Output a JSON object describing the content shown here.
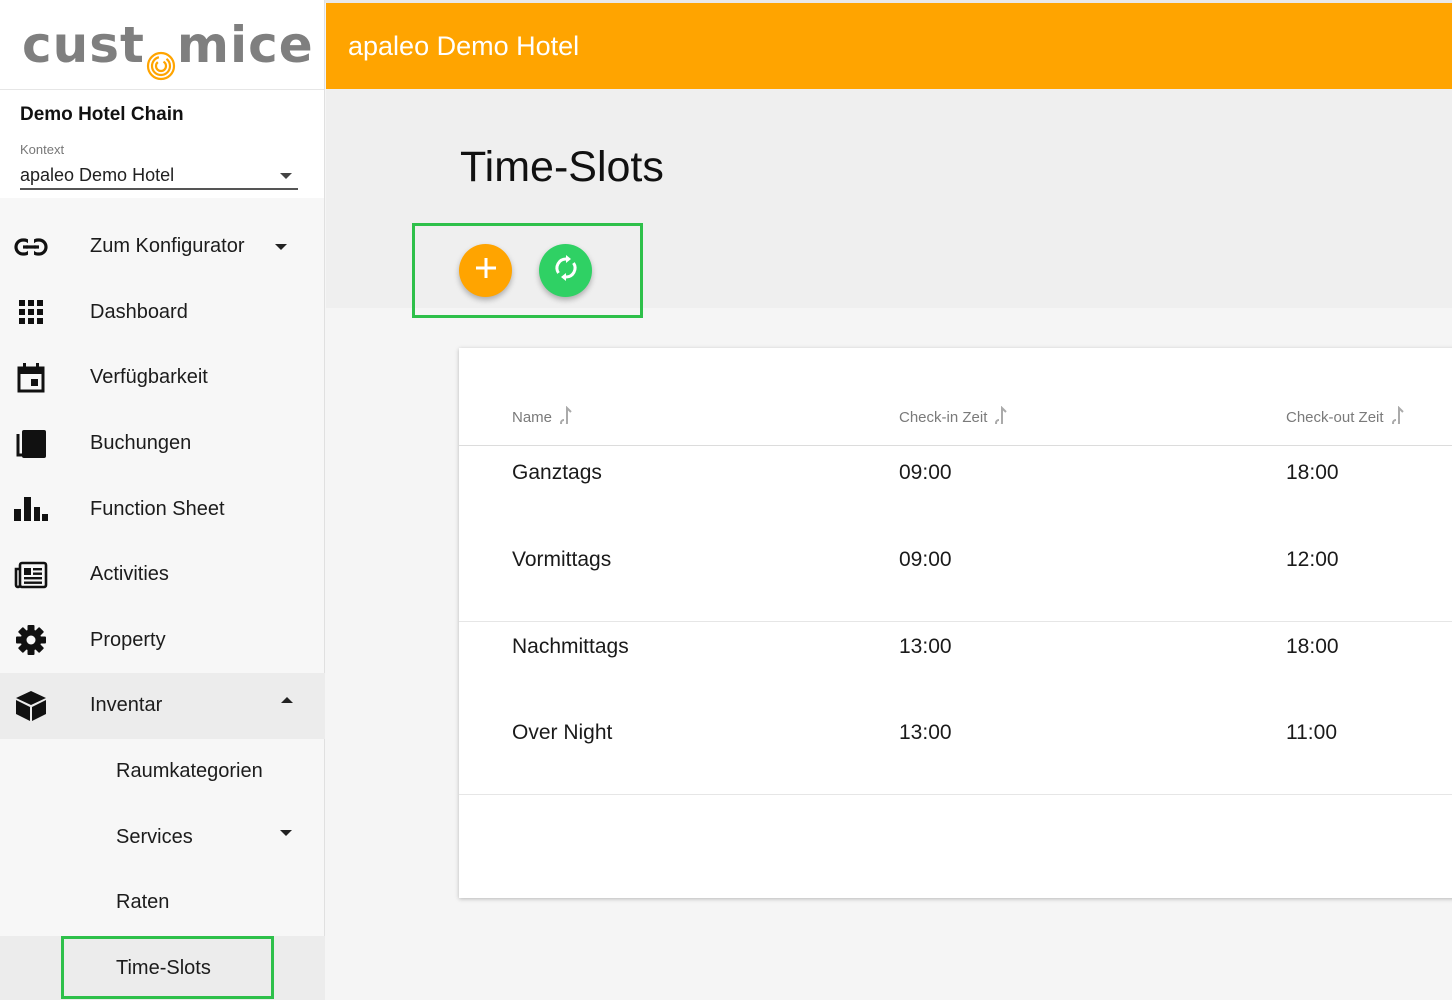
{
  "brand": {
    "logo_left": "cust",
    "logo_right": "mice"
  },
  "sidebar": {
    "chain_name": "Demo Hotel Chain",
    "context_label": "Kontext",
    "context_value": "apaleo Demo Hotel",
    "items": [
      {
        "label": "Zum Konfigurator",
        "icon": "link-icon"
      },
      {
        "label": "Dashboard",
        "icon": "grid-icon"
      },
      {
        "label": "Verfügbarkeit",
        "icon": "calendar-icon"
      },
      {
        "label": "Buchungen",
        "icon": "copy-icon"
      },
      {
        "label": "Function Sheet",
        "icon": "bar-chart-icon"
      },
      {
        "label": "Activities",
        "icon": "newspaper-icon"
      },
      {
        "label": "Property",
        "icon": "gear-icon"
      },
      {
        "label": "Inventar",
        "icon": "cube-icon"
      }
    ],
    "sub_items": [
      {
        "label": "Raumkategorien"
      },
      {
        "label": "Services"
      },
      {
        "label": "Raten"
      },
      {
        "label": "Time-Slots"
      }
    ]
  },
  "header": {
    "title": "apaleo Demo Hotel"
  },
  "page": {
    "title": "Time-Slots"
  },
  "table": {
    "columns": [
      "Name",
      "Check-in Zeit",
      "Check-out Zeit"
    ],
    "rows": [
      [
        "Ganztags",
        "09:00",
        "18:00"
      ],
      [
        "Vormittags",
        "09:00",
        "12:00"
      ],
      [
        "Nachmittags",
        "13:00",
        "18:00"
      ],
      [
        "Over Night",
        "13:00",
        "11:00"
      ]
    ]
  },
  "colors": {
    "accent": "#ffa400",
    "success": "#2fd164",
    "highlight": "#2ec04a"
  }
}
